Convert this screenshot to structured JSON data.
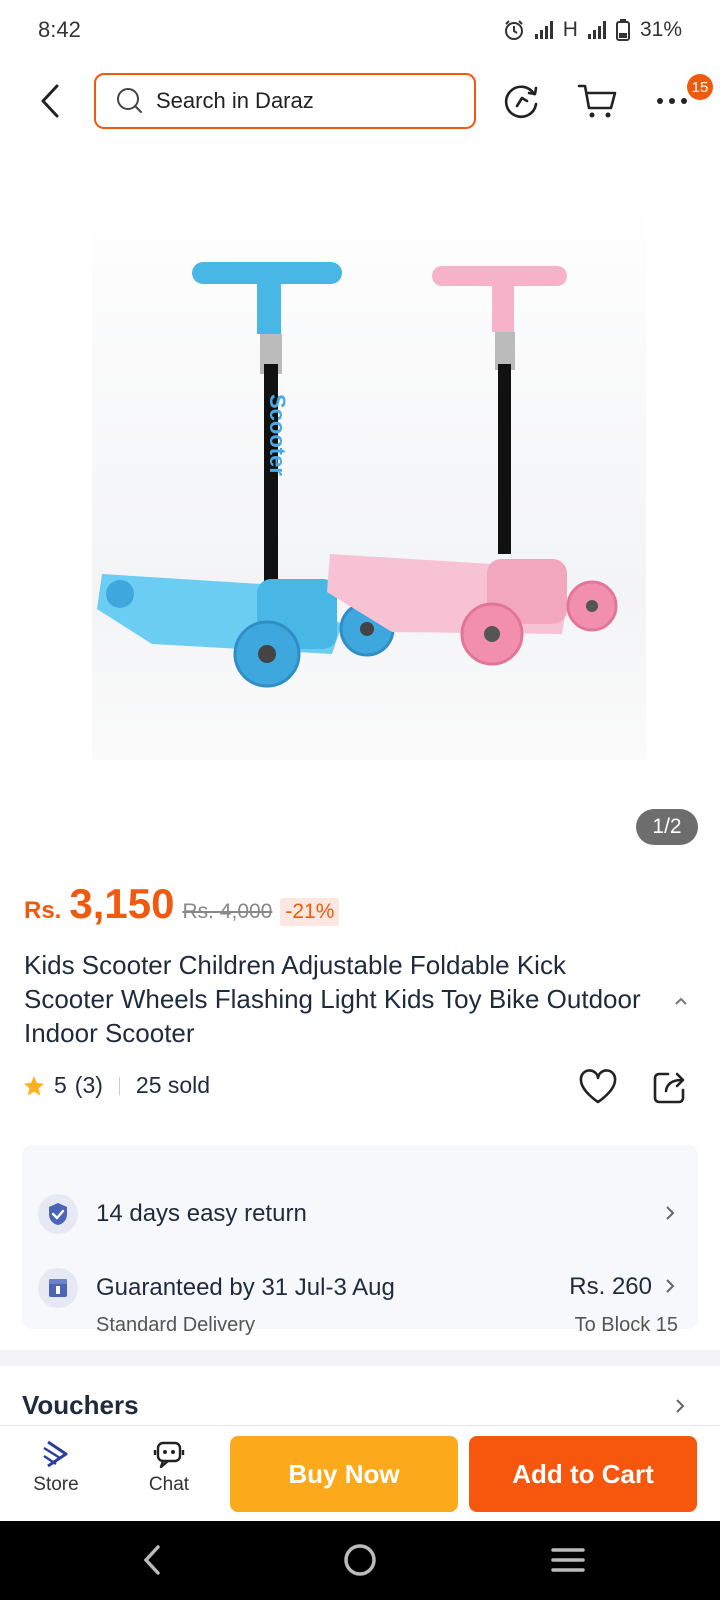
{
  "status": {
    "time": "8:42",
    "network": "H",
    "battery": "31%"
  },
  "header": {
    "search_placeholder": "Search in Daraz",
    "cart_badge": "15"
  },
  "gallery": {
    "counter": "1/2",
    "product_colors": [
      "#49b7e6",
      "#f3a7be"
    ],
    "scooter_text": "Scooter"
  },
  "product": {
    "currency": "Rs.",
    "price": "3,150",
    "original_price": "Rs. 4,000",
    "discount": "-21%",
    "title": "Kids Scooter Children Adjustable Foldable Kick Scooter Wheels Flashing Light Kids Toy Bike Outdoor Indoor Scooter",
    "rating": "5",
    "rating_count": "(3)",
    "sold": "25 sold"
  },
  "delivery": {
    "return_text": "14 days easy return",
    "guarantee_text": "Guaranteed by 31 Jul-3 Aug",
    "delivery_type": "Standard Delivery",
    "fee": "Rs. 260",
    "destination": "To Block 15"
  },
  "vouchers": {
    "label": "Vouchers"
  },
  "bottom_bar": {
    "store_label": "Store",
    "chat_label": "Chat",
    "buy_now_label": "Buy Now",
    "add_to_cart_label": "Add to Cart"
  },
  "colors": {
    "accent": "#f05a0e",
    "buy_now": "#fca91b",
    "add_to_cart": "#f7560d"
  }
}
